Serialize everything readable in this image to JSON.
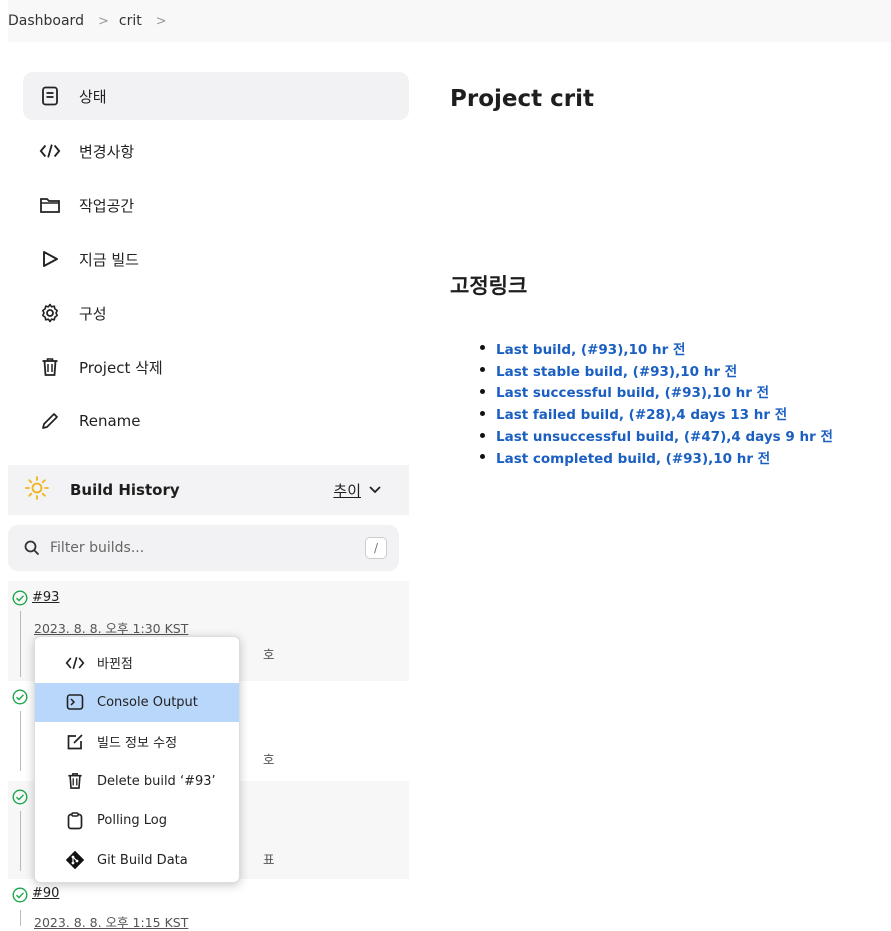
{
  "breadcrumb": {
    "items": [
      "Dashboard",
      "crit"
    ]
  },
  "sidebar": {
    "items": [
      {
        "label": "상태",
        "icon": "document-icon",
        "active": true
      },
      {
        "label": "변경사항",
        "icon": "code-icon"
      },
      {
        "label": "작업공간",
        "icon": "folder-icon"
      },
      {
        "label": "지금 빌드",
        "icon": "play-icon"
      },
      {
        "label": "구성",
        "icon": "gear-icon"
      },
      {
        "label": "Project 삭제",
        "icon": "trash-icon"
      },
      {
        "label": "Rename",
        "icon": "pencil-icon"
      }
    ]
  },
  "build_history": {
    "title": "Build History",
    "trend_label": "추이",
    "filter_placeholder": "Filter builds...",
    "filter_shortcut": "/",
    "builds": [
      {
        "number": "#93",
        "date": "2023. 8. 8. 오후 1:30 KST",
        "hint": "호"
      },
      {
        "hint": "호"
      },
      {
        "hint": "표"
      },
      {
        "number": "#90",
        "date": "2023. 8. 8. 오후 1:15 KST"
      }
    ]
  },
  "context_menu": {
    "items": [
      {
        "label": "바뀐점",
        "icon": "code-icon"
      },
      {
        "label": "Console Output",
        "icon": "terminal-icon",
        "highlighted": true
      },
      {
        "label": "빌드 정보 수정",
        "icon": "edit-icon"
      },
      {
        "label": "Delete build ‘#93’",
        "icon": "trash-icon"
      },
      {
        "label": "Polling Log",
        "icon": "clipboard-icon"
      },
      {
        "label": "Git Build Data",
        "icon": "git-icon"
      }
    ]
  },
  "main": {
    "title": "Project crit",
    "permalinks_title": "고정링크",
    "permalinks": [
      "Last build, (#93),10 hr 전",
      "Last stable build, (#93),10 hr 전",
      "Last successful build, (#93),10 hr 전",
      "Last failed build, (#28),4 days 13 hr 전",
      "Last unsuccessful build, (#47),4 days 9 hr 전",
      "Last completed build, (#93),10 hr 전"
    ]
  },
  "colors": {
    "link": "#1a5fc1",
    "success": "#1ea64b",
    "highlight": "#b8d7fb",
    "sun": "#f2b21b"
  }
}
